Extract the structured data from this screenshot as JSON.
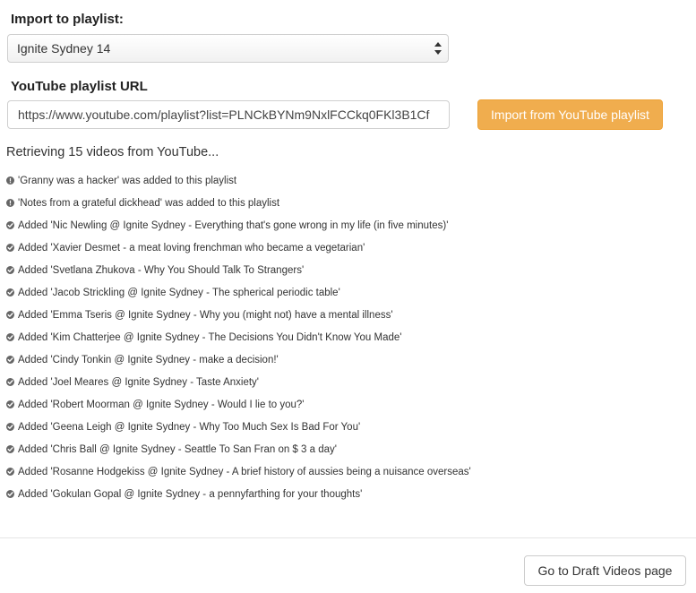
{
  "form": {
    "playlist_label": "Import to playlist:",
    "playlist_selected": "Ignite Sydney 14",
    "url_label": "YouTube playlist URL",
    "url_value": "https://www.youtube.com/playlist?list=PLNCkBYNm9NxlFCCkq0FKl3B1Cf",
    "import_button": "Import from YouTube playlist"
  },
  "status": "Retrieving 15 videos from YouTube...",
  "log": [
    {
      "type": "info",
      "icon": "exclamation-circle-icon",
      "text": "'Granny was a hacker' was added to this playlist"
    },
    {
      "type": "info",
      "icon": "exclamation-circle-icon",
      "text": "'Notes from a grateful dickhead' was added to this playlist"
    },
    {
      "type": "success",
      "icon": "check-circle-icon",
      "text": "Added 'Nic Newling @ Ignite Sydney - Everything that's gone wrong in my life (in five minutes)'"
    },
    {
      "type": "success",
      "icon": "check-circle-icon",
      "text": "Added 'Xavier Desmet - a meat loving frenchman who became a vegetarian'"
    },
    {
      "type": "success",
      "icon": "check-circle-icon",
      "text": "Added 'Svetlana Zhukova - Why You Should Talk To Strangers'"
    },
    {
      "type": "success",
      "icon": "check-circle-icon",
      "text": "Added 'Jacob Strickling @ Ignite Sydney - The spherical periodic table'"
    },
    {
      "type": "success",
      "icon": "check-circle-icon",
      "text": "Added 'Emma Tseris @ Ignite Sydney - Why you (might not) have a mental illness'"
    },
    {
      "type": "success",
      "icon": "check-circle-icon",
      "text": "Added 'Kim Chatterjee @ Ignite Sydney - The Decisions You Didn't Know You Made'"
    },
    {
      "type": "success",
      "icon": "check-circle-icon",
      "text": "Added 'Cindy Tonkin @ Ignite Sydney - make a decision!'"
    },
    {
      "type": "success",
      "icon": "check-circle-icon",
      "text": "Added 'Joel Meares @ Ignite Sydney - Taste Anxiety'"
    },
    {
      "type": "success",
      "icon": "check-circle-icon",
      "text": "Added 'Robert Moorman @ Ignite Sydney - Would I lie to you?'"
    },
    {
      "type": "success",
      "icon": "check-circle-icon",
      "text": "Added 'Geena Leigh @ Ignite Sydney - Why Too Much Sex Is Bad For You'"
    },
    {
      "type": "success",
      "icon": "check-circle-icon",
      "text": "Added 'Chris Ball @ Ignite Sydney - Seattle To San Fran on $ 3 a day'"
    },
    {
      "type": "success",
      "icon": "check-circle-icon",
      "text": "Added 'Rosanne Hodgekiss @ Ignite Sydney - A brief history of aussies being a nuisance overseas'"
    },
    {
      "type": "success",
      "icon": "check-circle-icon",
      "text": "Added 'Gokulan Gopal @ Ignite Sydney - a pennyfarthing for your thoughts'"
    }
  ],
  "footer": {
    "draft_button": "Go to Draft Videos page"
  },
  "colors": {
    "accent": "#f0ad4e",
    "icon": "#666666"
  }
}
